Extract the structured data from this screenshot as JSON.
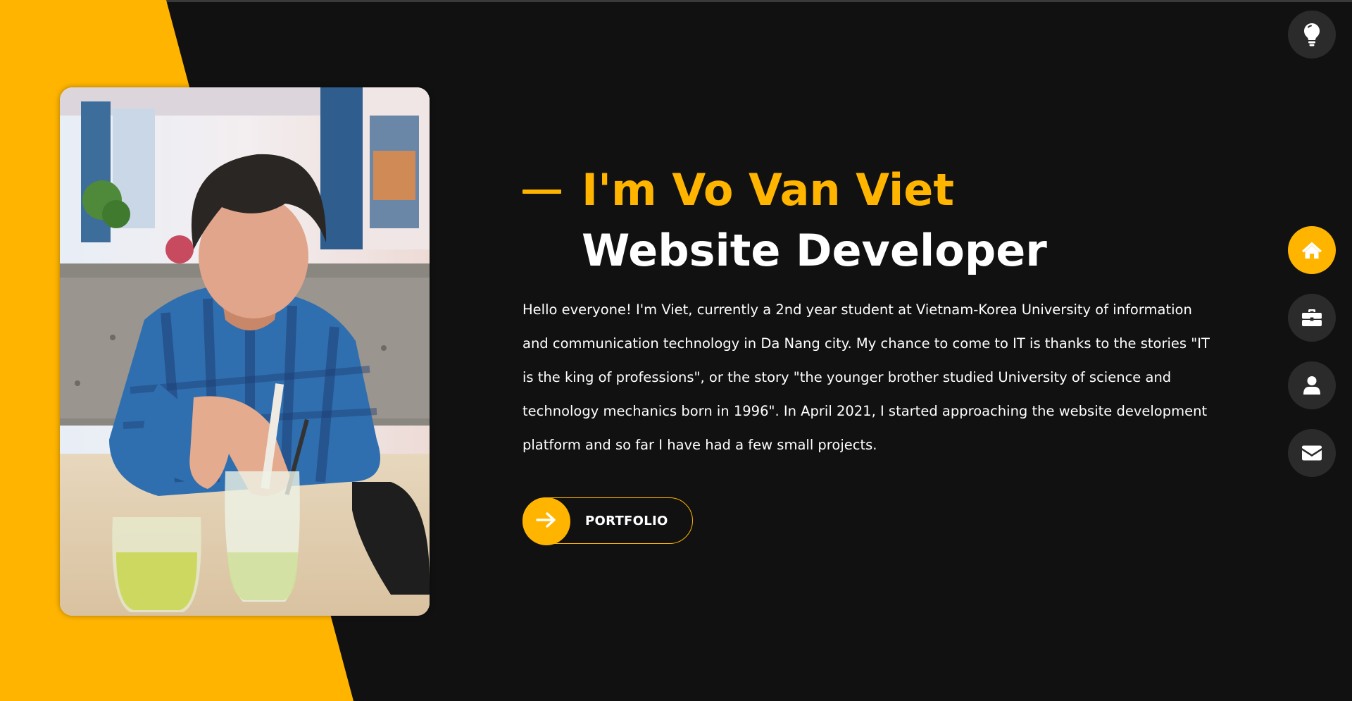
{
  "hero": {
    "name_line": "I'm Vo Van Viet",
    "role_line": "Website Developer",
    "about": "Hello everyone! I'm Viet, currently a 2nd year student at Vietnam-Korea University of information and communication technology in Da Nang city. My chance to come to IT is thanks to the stories \"IT is the king of professions\", or the story \"the younger brother studied University of science and technology mechanics born in 1996\". In April 2021, I started approaching the website development platform and so far I have had a few small projects.",
    "button_label": "PORTFOLIO"
  },
  "icons": {
    "theme_toggle": "lightbulb-icon",
    "button_arrow": "arrow-right-icon",
    "nav": [
      "home-icon",
      "briefcase-icon",
      "user-icon",
      "envelope-icon"
    ]
  },
  "colors": {
    "accent": "#ffb400",
    "background": "#111111",
    "nav_button": "#2b2b2b",
    "text": "#ffffff"
  },
  "nav": {
    "active": "home"
  }
}
